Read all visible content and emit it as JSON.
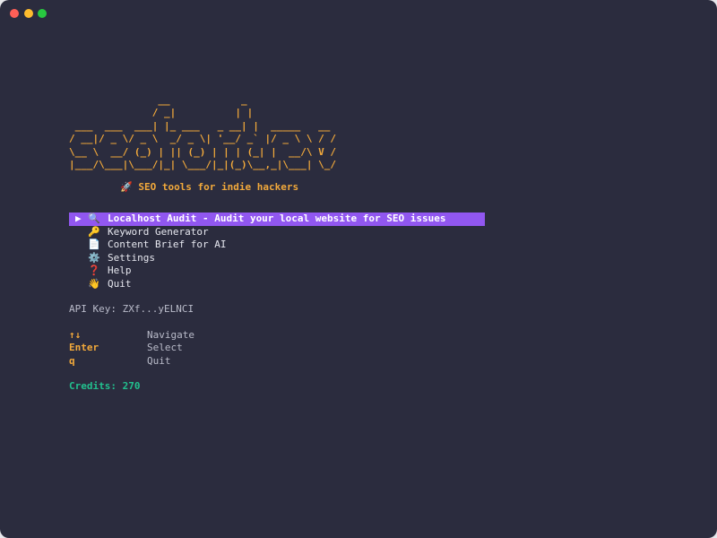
{
  "window": {
    "colors": {
      "background": "#2b2c3e",
      "accent": "#9157f0",
      "logo": "#f2a93b",
      "credits": "#22c08e",
      "close": "#ff5f57",
      "minimize": "#febc2e",
      "maximize": "#28c840"
    }
  },
  "logo": {
    "ascii": "               __            _\n              / _|          | |\n ___  ___  ___| |_ ___   _ __| |  _____   __\n/ __|/ _ \\/ _ \\  _/ _ \\| '__/ _` |/ _ \\ \\ / /\n\\__ \\  __/ (_) | || (_) | | | (_| |  __/\\ V /\n|___/\\___|\\___/|_| \\___/|_|(_)\\__,_|\\___| \\_/"
  },
  "tagline": {
    "icon": "rocket-icon",
    "glyph": "🚀",
    "text": "SEO tools for indie hackers"
  },
  "menu": {
    "pointer": "▶",
    "items": [
      {
        "icon": "magnifier-icon",
        "glyph": "🔍",
        "label": "Localhost Audit - Audit your local website for SEO issues",
        "selected": true
      },
      {
        "icon": "key-icon",
        "glyph": "🔑",
        "label": "Keyword Generator",
        "selected": false
      },
      {
        "icon": "document-icon",
        "glyph": "📄",
        "label": "Content Brief for AI",
        "selected": false
      },
      {
        "icon": "gear-icon",
        "glyph": "⚙️",
        "label": "Settings",
        "selected": false
      },
      {
        "icon": "question-icon",
        "glyph": "❓",
        "label": "Help",
        "selected": false
      },
      {
        "icon": "wave-icon",
        "glyph": "👋",
        "label": "Quit",
        "selected": false
      }
    ]
  },
  "api": {
    "label": "API Key: ",
    "value": "ZXf...yELNCI"
  },
  "keys": [
    {
      "key": "↑↓",
      "desc": "Navigate"
    },
    {
      "key": "Enter",
      "desc": "Select"
    },
    {
      "key": "q",
      "desc": "Quit"
    }
  ],
  "credits": {
    "label": "Credits: ",
    "value": "270"
  }
}
